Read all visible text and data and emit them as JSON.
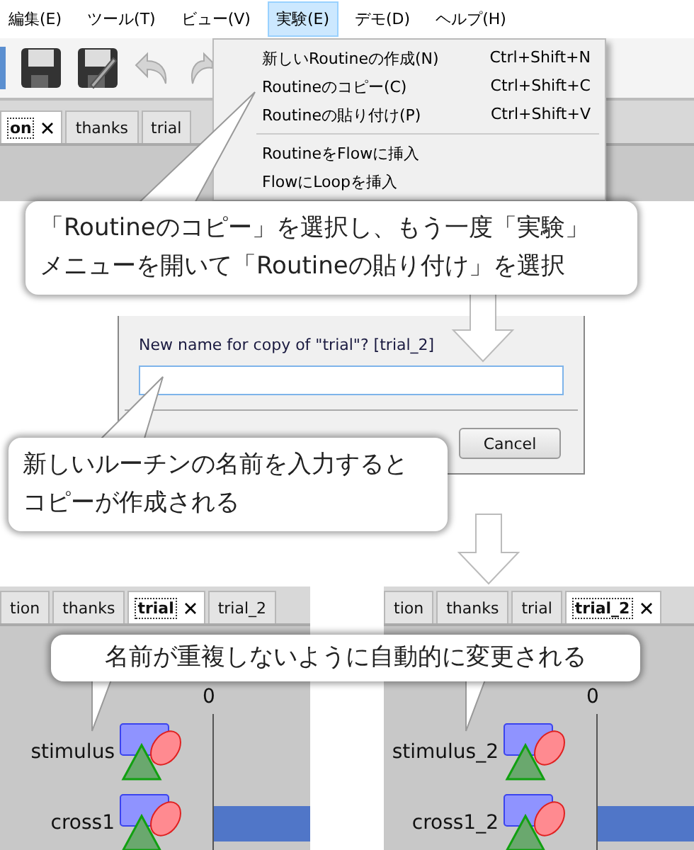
{
  "menu_bar": [
    {
      "label": "編集(E)",
      "selected": false
    },
    {
      "label": "ツール(T)",
      "selected": false
    },
    {
      "label": "ビュー(V)",
      "selected": false
    },
    {
      "label": "実験(E)",
      "selected": true
    },
    {
      "label": "デモ(D)",
      "selected": false
    },
    {
      "label": "ヘルプ(H)",
      "selected": false
    }
  ],
  "toolbar": [
    {
      "kind": "open"
    },
    {
      "kind": "save"
    },
    {
      "kind": "saveas"
    },
    {
      "kind": "undo"
    },
    {
      "kind": "redo"
    }
  ],
  "menu": {
    "items": [
      {
        "label": "新しいRoutineの作成(N)",
        "shortcut": "Ctrl+Shift+N",
        "separator_after": false
      },
      {
        "label": "Routineのコピー(C)",
        "shortcut": "Ctrl+Shift+C",
        "separator_after": false
      },
      {
        "label": "Routineの貼り付け(P)",
        "shortcut": "Ctrl+Shift+V",
        "separator_after": true
      },
      {
        "label": "RoutineをFlowに挿入",
        "separator_after": false
      },
      {
        "label": "FlowにLoopを挿入",
        "separator_after": false
      }
    ]
  },
  "top_tabs": [
    {
      "label": "on",
      "selected": true,
      "closable": true
    },
    {
      "label": "thanks",
      "selected": false,
      "closable": false
    },
    {
      "label": "trial",
      "selected": false,
      "closable": false
    }
  ],
  "callout_1": [
    "「Routineのコピー」を選択し、もう一度「実験」",
    "メニューを開いて「Routineの貼り付け」を選択"
  ],
  "dialog": {
    "prompt": "New name for copy of \"trial\"?  [trial_2]",
    "buttons": [
      {
        "label": "Cancel"
      }
    ]
  },
  "callout_2": [
    "新しいルーチンの名前を入力すると",
    "コピーが作成される"
  ],
  "panels": [
    {
      "tabs": [
        {
          "label": "tion",
          "selected": false,
          "closable": false
        },
        {
          "label": "thanks",
          "selected": false,
          "closable": false
        },
        {
          "label": "trial",
          "selected": true,
          "closable": true
        },
        {
          "label": "trial_2",
          "selected": false,
          "closable": false
        }
      ],
      "time_label": "0",
      "components": [
        {
          "name": "stimulus",
          "bar": false
        },
        {
          "name": "cross1",
          "bar": true
        }
      ]
    },
    {
      "tabs": [
        {
          "label": "tion",
          "selected": false,
          "closable": false
        },
        {
          "label": "thanks",
          "selected": false,
          "closable": false
        },
        {
          "label": "trial",
          "selected": false,
          "closable": false
        },
        {
          "label": "trial_2",
          "selected": true,
          "closable": true
        }
      ],
      "time_label": "0",
      "components": [
        {
          "name": "stimulus_2",
          "bar": false
        },
        {
          "name": "cross1_2",
          "bar": true
        }
      ]
    }
  ],
  "callout_3": "名前が重複しないように自動的に変更される"
}
